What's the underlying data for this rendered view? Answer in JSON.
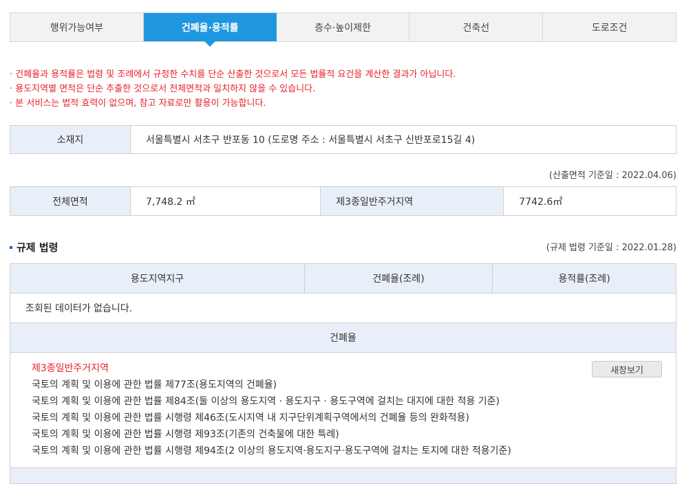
{
  "tabs": [
    {
      "label": "행위가능여부",
      "active": false
    },
    {
      "label": "건폐율·용적률",
      "active": true
    },
    {
      "label": "층수·높이제한",
      "active": false
    },
    {
      "label": "건축선",
      "active": false
    },
    {
      "label": "도로조건",
      "active": false
    }
  ],
  "notices": [
    "건폐율과 용적률은 법령 및 조례에서 규정한 수치를 단순 산출한 것으로서 모든 법률적 요건을 계산한 결과가 아닙니다.",
    "용도지역별 면적은 단순 추출한 것으로서 전체면적과 일치하지 않을 수 있습니다.",
    "본 서비스는 법적 효력이 없으며, 참고 자료로만 활용이 가능합니다."
  ],
  "location": {
    "label": "소재지",
    "value": "서울특별시 서초구 반포동 10 (도로명 주소 : 서울특별시 서초구 신반포로15길 4)"
  },
  "area_basis_date": "(산출면적 기준일 : 2022.04.06)",
  "area": {
    "total_label": "전체면적",
    "total_value": "7,748.2 ㎡",
    "zone_label": "제3종일반주거지역",
    "zone_value": "7742.6㎡"
  },
  "regulations": {
    "title": "규제 법령",
    "basis_date": "(규제 법령 기준일 : 2022.01.28)",
    "headers": [
      "용도지역지구",
      "건폐율(조례)",
      "용적률(조례)"
    ],
    "no_data": "조회된 데이터가 없습니다.",
    "subheader": "건폐율",
    "zone_name": "제3종일반주거지역",
    "new_window_label": "새창보기",
    "laws": [
      "국토의 계획 및 이용에 관한 법률 제77조(용도지역의 건폐율)",
      "국토의 계획 및 이용에 관한 법률 제84조(둘 이상의 용도지역 · 용도지구 · 용도구역에 걸치는 대지에 대한 적용 기준)",
      "국토의 계획 및 이용에 관한 법률 시행령 제46조(도시지역 내 지구단위계획구역에서의 건폐율 등의 완화적용)",
      "국토의 계획 및 이용에 관한 법률 시행령 제93조(기존의 건축물에 대한 특례)",
      "국토의 계획 및 이용에 관한 법률 시행령 제94조(2 이상의 용도지역·용도지구·용도구역에 걸치는 토지에 대한 적용기준)"
    ]
  }
}
